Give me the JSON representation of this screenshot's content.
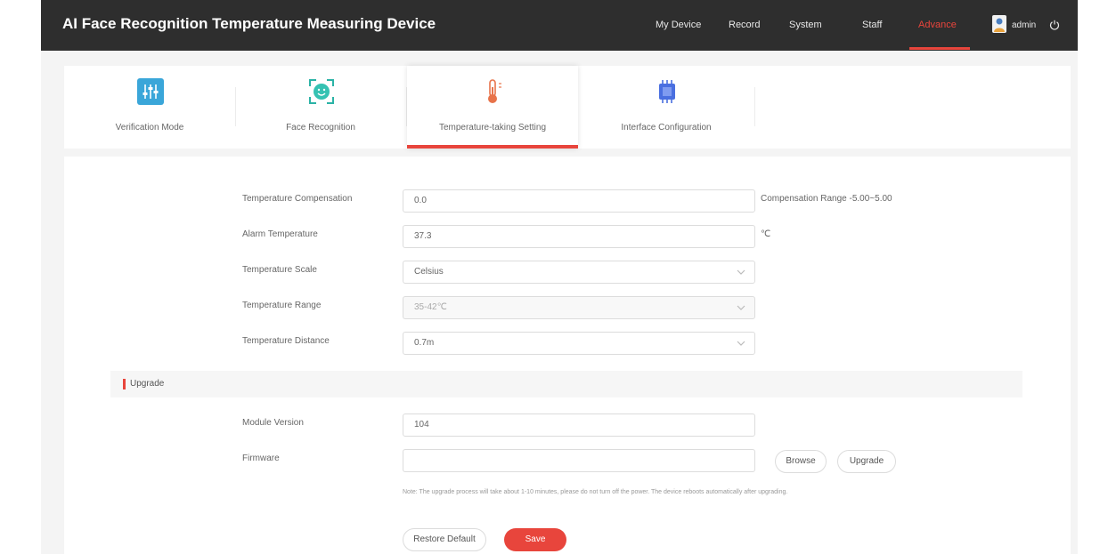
{
  "header": {
    "title": "AI Face Recognition Temperature Measuring Device",
    "nav": [
      {
        "label": "My Device"
      },
      {
        "label": "Record"
      },
      {
        "label": "System"
      },
      {
        "label": "Staff"
      },
      {
        "label": "Advance",
        "active": true
      }
    ],
    "user": "admin",
    "accent_color": "#e8453c",
    "icons": [
      "user-icon",
      "power-icon"
    ]
  },
  "tabs": [
    {
      "label": "Verification Mode",
      "icon": "sliders-icon"
    },
    {
      "label": "Face Recognition",
      "icon": "face-icon"
    },
    {
      "label": "Temperature-taking Setting",
      "icon": "thermometer-icon",
      "active": true
    },
    {
      "label": "Interface Configuration",
      "icon": "chip-icon"
    }
  ],
  "temperature": {
    "compensation": {
      "label": "Temperature Compensation",
      "value": "0.0",
      "hint": "Compensation Range -5.00~5.00"
    },
    "alarm": {
      "label": "Alarm Temperature",
      "value": "37.3",
      "unit": "℃"
    },
    "scale": {
      "label": "Temperature Scale",
      "value": "Celsius"
    },
    "range": {
      "label": "Temperature Range",
      "value": "35-42℃"
    },
    "distance": {
      "label": "Temperature Distance",
      "value": "0.7m"
    }
  },
  "upgrade": {
    "section_title": "Upgrade",
    "module_version_label": "Module Version",
    "module_version_value": "104",
    "firmware_label": "Firmware",
    "firmware_value": "",
    "browse_label": "Browse",
    "upgrade_label": "Upgrade",
    "note": "Note: The upgrade process will take about 1-10 minutes, please do not turn off the power. The device reboots automatically after upgrading."
  },
  "actions": {
    "restore_label": "Restore Default",
    "save_label": "Save"
  }
}
